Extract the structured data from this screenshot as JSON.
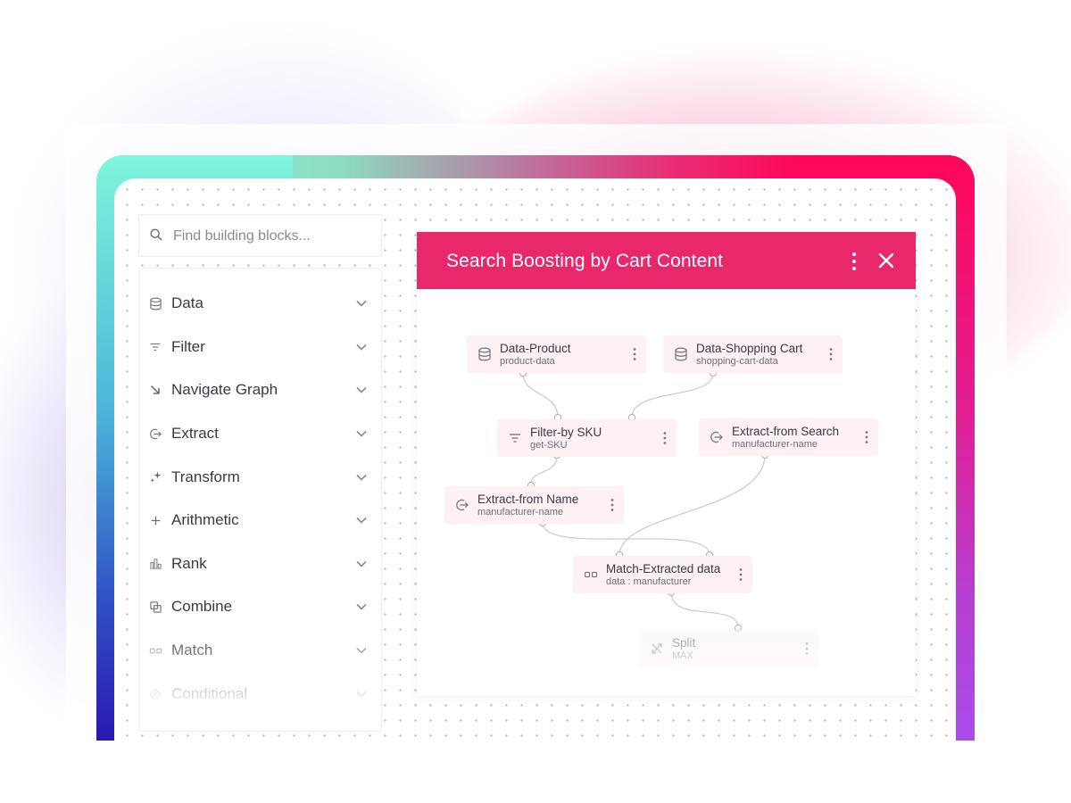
{
  "search": {
    "placeholder": "Find building blocks..."
  },
  "sidebar": {
    "categories": [
      {
        "label": "Data",
        "icon": "database-icon"
      },
      {
        "label": "Filter",
        "icon": "filter-icon"
      },
      {
        "label": "Navigate Graph",
        "icon": "arrow-down-right-icon"
      },
      {
        "label": "Extract",
        "icon": "extract-icon"
      },
      {
        "label": "Transform",
        "icon": "sparkle-icon"
      },
      {
        "label": "Arithmetic",
        "icon": "plus-icon"
      },
      {
        "label": "Rank",
        "icon": "bar-chart-icon"
      },
      {
        "label": "Combine",
        "icon": "combine-icon"
      },
      {
        "label": "Match",
        "icon": "match-icon"
      },
      {
        "label": "Conditional",
        "icon": "diamond-icon"
      }
    ]
  },
  "flow": {
    "title": "Search Boosting by Cart Content",
    "nodes": [
      {
        "title": "Data-Product",
        "subtitle": "product-data",
        "icon": "database-icon"
      },
      {
        "title": "Data-Shopping Cart",
        "subtitle": "shopping-cart-data",
        "icon": "database-icon"
      },
      {
        "title": "Filter-by SKU",
        "subtitle": "get-SKU",
        "icon": "filter-icon"
      },
      {
        "title": "Extract-from Search",
        "subtitle": "manufacturer-name",
        "icon": "extract-icon"
      },
      {
        "title": "Extract-from Name",
        "subtitle": "manufacturer-name",
        "icon": "extract-icon"
      },
      {
        "title": "Match-Extracted data",
        "subtitle": "data : manufacturer",
        "icon": "match-icon"
      },
      {
        "title": "Split",
        "subtitle": "MAX",
        "icon": "split-icon"
      }
    ]
  },
  "colors": {
    "header": "#e8286a",
    "node_bg": "#fdf1f4",
    "frame_left": "#7ff6dc",
    "frame_right": "#ff0659"
  }
}
